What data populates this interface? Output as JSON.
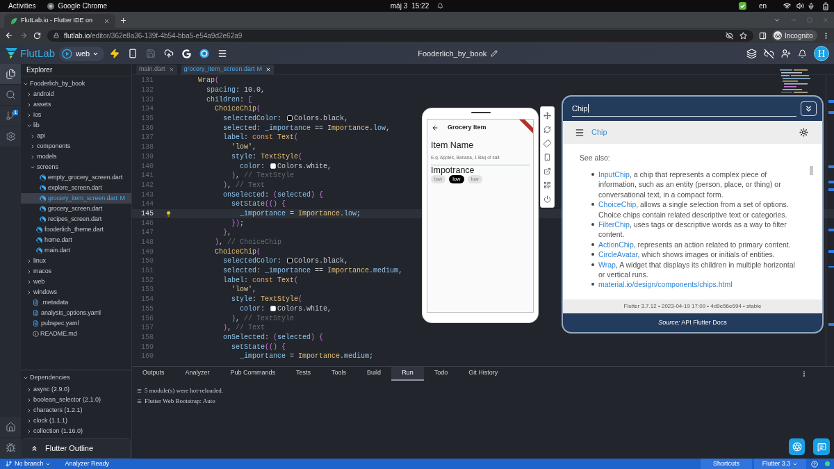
{
  "system_bar": {
    "activities": "Activities",
    "app_name": "Google Chrome",
    "date": "máj 3",
    "time": "15:22",
    "language": "en"
  },
  "browser": {
    "tabs": [
      {
        "title": "FlutLab.io - Flutter IDE on",
        "selected": true
      }
    ],
    "address": {
      "host": "flutlab.io",
      "path": "/editor/362e8a36-139f-4b54-bba5-e54a9d2e62a9"
    },
    "profile": "Incognito"
  },
  "app_header": {
    "brand": "FlutLab",
    "run_target": "web",
    "project_name": "Fooderlich_by_book",
    "avatar": "H"
  },
  "activity_bar": {
    "items": [
      {
        "kind": "files",
        "selected": true
      },
      {
        "kind": "search",
        "selected": false
      },
      {
        "kind": "source_control",
        "selected": false,
        "badge": "1"
      },
      {
        "kind": "settings",
        "selected": false
      }
    ],
    "bottom_items": [
      {
        "kind": "home"
      },
      {
        "kind": "debug"
      }
    ]
  },
  "explorer": {
    "title": "Explorer",
    "tree": [
      {
        "label": "Fooderlich_by_book",
        "kind": "folder",
        "expanded": true,
        "selected": false,
        "children": [
          {
            "label": "android",
            "kind": "folder",
            "expanded": false,
            "selected": false
          },
          {
            "label": "assets",
            "kind": "folder",
            "expanded": false,
            "selected": false
          },
          {
            "label": "ios",
            "kind": "folder",
            "expanded": false,
            "selected": false
          },
          {
            "label": "lib",
            "kind": "folder",
            "expanded": true,
            "selected": false,
            "children": [
              {
                "label": "api",
                "kind": "folder",
                "expanded": false,
                "selected": false
              },
              {
                "label": "components",
                "kind": "folder",
                "expanded": false,
                "selected": false
              },
              {
                "label": "models",
                "kind": "folder",
                "expanded": false,
                "selected": false
              },
              {
                "label": "screens",
                "kind": "folder",
                "expanded": true,
                "selected": false,
                "children": [
                  {
                    "label": "empty_grocery_screen.dart",
                    "kind": "dart",
                    "selected": false
                  },
                  {
                    "label": "explore_screen.dart",
                    "kind": "dart",
                    "selected": false
                  },
                  {
                    "label": "grocery_item_screen.dart",
                    "kind": "dart",
                    "selected": true,
                    "badge": "M"
                  },
                  {
                    "label": "grocery_screen.dart",
                    "kind": "dart",
                    "selected": false
                  },
                  {
                    "label": "recipes_screen.dart",
                    "kind": "dart",
                    "selected": false
                  }
                ]
              },
              {
                "label": "fooderlich_theme.dart",
                "kind": "dart",
                "selected": false
              },
              {
                "label": "home.dart",
                "kind": "dart",
                "selected": false
              },
              {
                "label": "main.dart",
                "kind": "dart",
                "selected": false
              }
            ]
          },
          {
            "label": "linux",
            "kind": "folder",
            "expanded": false,
            "selected": false
          },
          {
            "label": "macos",
            "kind": "folder",
            "expanded": false,
            "selected": false
          },
          {
            "label": "web",
            "kind": "folder",
            "expanded": false,
            "selected": false
          },
          {
            "label": "windows",
            "kind": "folder",
            "expanded": false,
            "selected": false
          },
          {
            "label": ".metadata",
            "kind": "file",
            "selected": false
          },
          {
            "label": "analysis_options.yaml",
            "kind": "file",
            "selected": false
          },
          {
            "label": "pubspec.yaml",
            "kind": "file",
            "selected": false
          },
          {
            "label": "README.md",
            "kind": "info",
            "selected": false
          }
        ]
      }
    ],
    "dependencies": {
      "title": "Dependencies",
      "expanded": true,
      "items": [
        {
          "label": "async (2.9.0)",
          "expanded": false
        },
        {
          "label": "boolean_selector (2.1.0)",
          "expanded": false
        },
        {
          "label": "characters (1.2.1)",
          "expanded": false
        },
        {
          "label": "clock (1.1.1)",
          "expanded": false
        },
        {
          "label": "collection (1.16.0)",
          "expanded": false
        }
      ]
    },
    "outline": {
      "title": "Flutter Outline"
    }
  },
  "editor": {
    "tabs": [
      {
        "label": "main.dart",
        "selected": false
      },
      {
        "label": "grocery_item_screen.dart",
        "selected": true,
        "badge": "M"
      }
    ],
    "lines": [
      {
        "number": "131",
        "selected": false,
        "tokens": [
          {
            "kind": "class",
            "text": "          Wrap"
          },
          {
            "kind": "bracket",
            "text": "("
          }
        ]
      },
      {
        "number": "132",
        "selected": false,
        "tokens": [
          {
            "kind": "property",
            "text": "            spacing"
          },
          {
            "kind": "punctuation",
            "text": ": 10.0,"
          }
        ]
      },
      {
        "number": "133",
        "selected": false,
        "tokens": [
          {
            "kind": "property",
            "text": "            children"
          },
          {
            "kind": "punctuation",
            "text": ": "
          },
          {
            "kind": "bracket",
            "text": "["
          }
        ]
      },
      {
        "number": "134",
        "selected": false,
        "tokens": [
          {
            "kind": "class",
            "text": "              ChoiceChip"
          },
          {
            "kind": "bracket",
            "text": "("
          }
        ]
      },
      {
        "number": "135",
        "selected": false,
        "tokens": [
          {
            "kind": "property",
            "text": "                selectedColor"
          },
          {
            "kind": "punctuation",
            "text": ": "
          },
          {
            "kind": "swatch",
            "color": "#000000"
          },
          {
            "kind": "punctuation",
            "text": "Colors.black,"
          }
        ]
      },
      {
        "number": "136",
        "selected": false,
        "tokens": [
          {
            "kind": "property",
            "text": "                selected"
          },
          {
            "kind": "punctuation",
            "text": ": "
          },
          {
            "kind": "property",
            "text": "_importance"
          },
          {
            "kind": "punctuation",
            "text": " == "
          },
          {
            "kind": "class",
            "text": "Importance"
          },
          {
            "kind": "punctuation",
            "text": "."
          },
          {
            "kind": "property",
            "text": "low"
          },
          {
            "kind": "punctuation",
            "text": ","
          }
        ]
      },
      {
        "number": "137",
        "selected": false,
        "tokens": [
          {
            "kind": "property",
            "text": "                label"
          },
          {
            "kind": "punctuation",
            "text": ": "
          },
          {
            "kind": "keyword",
            "text": "const "
          },
          {
            "kind": "class",
            "text": "Text"
          },
          {
            "kind": "bracket",
            "text": "("
          }
        ]
      },
      {
        "number": "138",
        "selected": false,
        "tokens": [
          {
            "kind": "string",
            "text": "                  'low'"
          },
          {
            "kind": "punctuation",
            "text": ","
          }
        ]
      },
      {
        "number": "139",
        "selected": false,
        "tokens": [
          {
            "kind": "property",
            "text": "                  style"
          },
          {
            "kind": "punctuation",
            "text": ": "
          },
          {
            "kind": "class",
            "text": "TextStyle"
          },
          {
            "kind": "bracket",
            "text": "("
          }
        ]
      },
      {
        "number": "140",
        "selected": false,
        "tokens": [
          {
            "kind": "property",
            "text": "                    color"
          },
          {
            "kind": "punctuation",
            "text": ": "
          },
          {
            "kind": "swatch",
            "color": "#ffffff"
          },
          {
            "kind": "punctuation",
            "text": "Colors.white,"
          }
        ]
      },
      {
        "number": "141",
        "selected": false,
        "tokens": [
          {
            "kind": "bracket",
            "text": "                  )"
          },
          {
            "kind": "punctuation",
            "text": ", "
          },
          {
            "kind": "comment",
            "text": "// TextStyle"
          }
        ]
      },
      {
        "number": "142",
        "selected": false,
        "tokens": [
          {
            "kind": "bracket",
            "text": "                )"
          },
          {
            "kind": "punctuation",
            "text": ", "
          },
          {
            "kind": "comment",
            "text": "// Text"
          }
        ]
      },
      {
        "number": "143",
        "selected": false,
        "tokens": [
          {
            "kind": "property",
            "text": "                onSelected"
          },
          {
            "kind": "punctuation",
            "text": ": "
          },
          {
            "kind": "bracket",
            "text": "("
          },
          {
            "kind": "property",
            "text": "selected"
          },
          {
            "kind": "bracket",
            "text": ") {"
          }
        ]
      },
      {
        "number": "144",
        "selected": false,
        "tokens": [
          {
            "kind": "property",
            "text": "                  setState"
          },
          {
            "kind": "bracket",
            "text": "(() {"
          }
        ]
      },
      {
        "number": "145",
        "selected": true,
        "tokens": [
          {
            "kind": "property",
            "text": "                    _importance"
          },
          {
            "kind": "punctuation",
            "text": " = "
          },
          {
            "kind": "class",
            "text": "Importance"
          },
          {
            "kind": "punctuation",
            "text": "."
          },
          {
            "kind": "property",
            "text": "low"
          },
          {
            "kind": "punctuation",
            "text": ";"
          }
        ]
      },
      {
        "number": "146",
        "selected": false,
        "tokens": [
          {
            "kind": "bracket",
            "text": "                  })"
          },
          {
            "kind": "punctuation",
            "text": ";"
          }
        ]
      },
      {
        "number": "147",
        "selected": false,
        "tokens": [
          {
            "kind": "bracket",
            "text": "                }"
          },
          {
            "kind": "punctuation",
            "text": ","
          }
        ]
      },
      {
        "number": "148",
        "selected": false,
        "tokens": [
          {
            "kind": "bracket",
            "text": "              )"
          },
          {
            "kind": "punctuation",
            "text": ", "
          },
          {
            "kind": "comment",
            "text": "// ChoiceChip"
          }
        ]
      },
      {
        "number": "149",
        "selected": false,
        "tokens": [
          {
            "kind": "class",
            "text": "              ChoiceChip"
          },
          {
            "kind": "bracket",
            "text": "("
          }
        ]
      },
      {
        "number": "150",
        "selected": false,
        "tokens": [
          {
            "kind": "property",
            "text": "                selectedColor"
          },
          {
            "kind": "punctuation",
            "text": ": "
          },
          {
            "kind": "swatch",
            "color": "#000000"
          },
          {
            "kind": "punctuation",
            "text": "Colors.black,"
          }
        ]
      },
      {
        "number": "151",
        "selected": false,
        "tokens": [
          {
            "kind": "property",
            "text": "                selected"
          },
          {
            "kind": "punctuation",
            "text": ": "
          },
          {
            "kind": "property",
            "text": "_importance"
          },
          {
            "kind": "punctuation",
            "text": " == "
          },
          {
            "kind": "class",
            "text": "Importance"
          },
          {
            "kind": "punctuation",
            "text": "."
          },
          {
            "kind": "property",
            "text": "medium"
          },
          {
            "kind": "punctuation",
            "text": ","
          }
        ]
      },
      {
        "number": "152",
        "selected": false,
        "tokens": [
          {
            "kind": "property",
            "text": "                label"
          },
          {
            "kind": "punctuation",
            "text": ": "
          },
          {
            "kind": "keyword",
            "text": "const "
          },
          {
            "kind": "class",
            "text": "Text"
          },
          {
            "kind": "bracket",
            "text": "("
          }
        ]
      },
      {
        "number": "153",
        "selected": false,
        "tokens": [
          {
            "kind": "string",
            "text": "                  'low'"
          },
          {
            "kind": "punctuation",
            "text": ","
          }
        ]
      },
      {
        "number": "154",
        "selected": false,
        "tokens": [
          {
            "kind": "property",
            "text": "                  style"
          },
          {
            "kind": "punctuation",
            "text": ": "
          },
          {
            "kind": "class",
            "text": "TextStyle"
          },
          {
            "kind": "bracket",
            "text": "("
          }
        ]
      },
      {
        "number": "155",
        "selected": false,
        "tokens": [
          {
            "kind": "property",
            "text": "                    color"
          },
          {
            "kind": "punctuation",
            "text": ": "
          },
          {
            "kind": "swatch",
            "color": "#ffffff"
          },
          {
            "kind": "punctuation",
            "text": "Colors.white,"
          }
        ]
      },
      {
        "number": "156",
        "selected": false,
        "tokens": [
          {
            "kind": "bracket",
            "text": "                  )"
          },
          {
            "kind": "punctuation",
            "text": ", "
          },
          {
            "kind": "comment",
            "text": "// TextStyle"
          }
        ]
      },
      {
        "number": "157",
        "selected": false,
        "tokens": [
          {
            "kind": "bracket",
            "text": "                )"
          },
          {
            "kind": "punctuation",
            "text": ", "
          },
          {
            "kind": "comment",
            "text": "// Text"
          }
        ]
      },
      {
        "number": "158",
        "selected": false,
        "tokens": [
          {
            "kind": "property",
            "text": "                onSelected"
          },
          {
            "kind": "punctuation",
            "text": ": "
          },
          {
            "kind": "bracket",
            "text": "("
          },
          {
            "kind": "property",
            "text": "selected"
          },
          {
            "kind": "bracket",
            "text": ") {"
          }
        ]
      },
      {
        "number": "159",
        "selected": false,
        "tokens": [
          {
            "kind": "property",
            "text": "                  setState"
          },
          {
            "kind": "bracket",
            "text": "(() {"
          }
        ]
      },
      {
        "number": "160",
        "selected": false,
        "tokens": [
          {
            "kind": "property",
            "text": "                    _importance"
          },
          {
            "kind": "punctuation",
            "text": " = "
          },
          {
            "kind": "class",
            "text": "Importance"
          },
          {
            "kind": "punctuation",
            "text": "."
          },
          {
            "kind": "property",
            "text": "medium"
          },
          {
            "kind": "punctuation",
            "text": ";"
          }
        ]
      }
    ]
  },
  "preview": {
    "app_bar": {
      "title": "Grocery Item"
    },
    "field_label": "Item Name",
    "name_field": {
      "placeholder": "E.g. Apples, Banana, 1 Bag of salt"
    },
    "section_label": "Impotrance",
    "chips": [
      {
        "label": "low",
        "selected": false
      },
      {
        "label": "low",
        "selected": true
      },
      {
        "label": "low",
        "selected": false
      }
    ]
  },
  "docs_popup": {
    "search": {
      "value": "Chip"
    },
    "page_title": "Chip",
    "heading": "See also:",
    "items": [
      {
        "link": "InputChip",
        "text": ", a chip that represents a complex piece of information, such as an entity (person, place, or thing) or conversational text, in a compact form."
      },
      {
        "link": "ChoiceChip",
        "text": ", allows a single selection from a set of options. Choice chips contain related descriptive text or categories."
      },
      {
        "link": "FilterChip",
        "text": ", uses tags or descriptive words as a way to filter content."
      },
      {
        "link": "ActionChip",
        "text": ", represents an action related to primary content."
      },
      {
        "link": "CircleAvatar",
        "text": ", which shows images or initials of entities."
      },
      {
        "link": "Wrap",
        "text": ", A widget that displays its children in multiple horizontal or vertical runs."
      },
      {
        "link": "material.io/design/components/chips.html"
      }
    ],
    "version_info": "Flutter 3.7.12 • 2023-04-19 17:09 • 4d9e56e694 • stable",
    "source": "*Source:* API Flutter Docs"
  },
  "bottom_panel": {
    "tabs": [
      {
        "label": "Outputs",
        "selected": false
      },
      {
        "label": "Analyzer",
        "selected": false
      },
      {
        "label": "Pub Commands",
        "selected": false
      },
      {
        "label": "Tests",
        "selected": false
      },
      {
        "label": "Tools",
        "selected": false
      },
      {
        "label": "Build",
        "selected": false
      },
      {
        "label": "Run",
        "selected": true
      },
      {
        "label": "Todo",
        "selected": false
      },
      {
        "label": "Git History",
        "selected": false
      }
    ],
    "output_lines": [
      "5 module(s) were hot-reloaded.",
      "Flutter Web Bootstrap: Auto"
    ]
  },
  "status_bar": {
    "branch": "No branch",
    "analyzer_status": "Analyzer Ready",
    "shortcuts": "Shortcuts",
    "flutter_version": "Flutter 3.3"
  }
}
